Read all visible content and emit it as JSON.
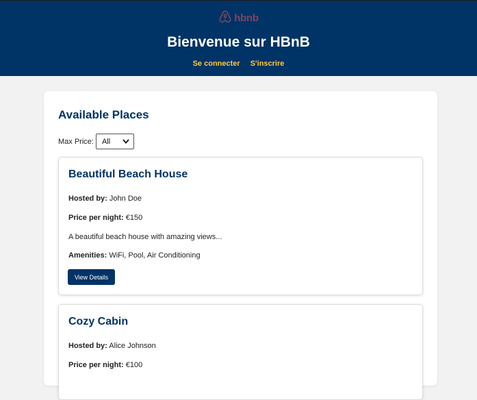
{
  "header": {
    "logo_text": "hbnb",
    "title": "Bienvenue sur HBnB",
    "nav": {
      "login": "Se connecter",
      "register": "S'inscrire"
    }
  },
  "main": {
    "title": "Available Places",
    "filter": {
      "label": "Max Price:",
      "selected": "All"
    },
    "places": [
      {
        "title": "Beautiful Beach House",
        "host_label": "Hosted by:",
        "host": "John Doe",
        "price_label": "Price per night:",
        "price": "€150",
        "description": "A beautiful beach house with amazing views...",
        "amenities_label": "Amenities:",
        "amenities": "WiFi, Pool, Air Conditioning",
        "button": "View Details"
      },
      {
        "title": "Cozy Cabin",
        "host_label": "Hosted by:",
        "host": "Alice Johnson",
        "price_label": "Price per night:",
        "price": "€100"
      }
    ]
  },
  "colors": {
    "brand": "#003366",
    "accent": "#ffcc33",
    "logo": "#e0565b"
  },
  "icons": {
    "logo": "airbnb-logo-icon",
    "select": "chevron-down-icon"
  }
}
